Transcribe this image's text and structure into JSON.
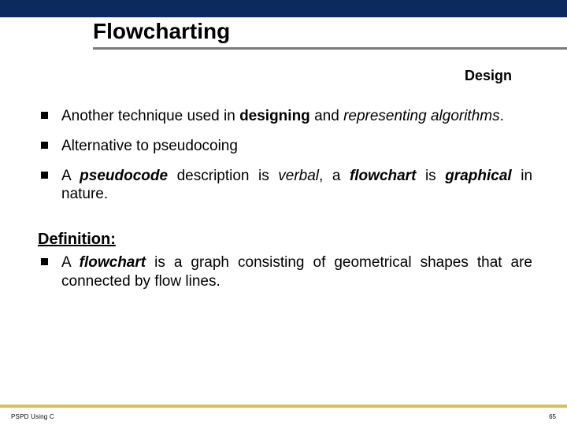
{
  "slide": {
    "title": "Flowcharting",
    "section": "Design",
    "bullets_main": [
      {
        "segments": [
          {
            "t": "Another technique used in "
          },
          {
            "t": "designing",
            "cls": "b"
          },
          {
            "t": " and  "
          },
          {
            "t": "representing algorithms",
            "cls": "i"
          },
          {
            "t": "."
          }
        ]
      },
      {
        "segments": [
          {
            "t": "Alternative to pseudocoing"
          }
        ]
      },
      {
        "segments": [
          {
            "t": "A "
          },
          {
            "t": "pseudocode",
            "cls": "bi"
          },
          {
            "t": " description is "
          },
          {
            "t": "verbal",
            "cls": "i"
          },
          {
            "t": ", a "
          },
          {
            "t": "flowchart",
            "cls": "bi"
          },
          {
            "t": " is "
          },
          {
            "t": "graphical",
            "cls": "bi"
          },
          {
            "t": " in nature."
          }
        ]
      }
    ],
    "definition_label": "Definition:",
    "bullets_def": [
      {
        "segments": [
          {
            "t": "A "
          },
          {
            "t": "flowchart",
            "cls": "bi"
          },
          {
            "t": " is a graph consisting of geometrical shapes that are connected by flow lines."
          }
        ]
      }
    ],
    "footer_left": "PSPD Using C",
    "footer_right": "65"
  }
}
